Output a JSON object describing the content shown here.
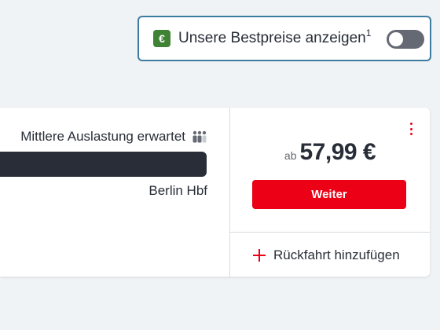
{
  "best_price_toggle": {
    "icon": "euro-icon",
    "icon_glyph": "€",
    "label": "Unsere Bestpreise anzeigen",
    "footnote": "1",
    "enabled": false,
    "icon_color": "#408335",
    "border_color": "#3c7d9f"
  },
  "connection": {
    "occupancy_label": "Mittlere Auslastung erwartet",
    "occupancy_icon": "people-icon",
    "destination": "Berlin Hbf",
    "price_prefix": "ab",
    "price": "57,99 €",
    "continue_label": "Weiter",
    "more_icon": "more-vertical-icon",
    "return_icon": "plus-icon",
    "return_label": "Rückfahrt hinzufügen",
    "accent_color": "#ec0016"
  }
}
